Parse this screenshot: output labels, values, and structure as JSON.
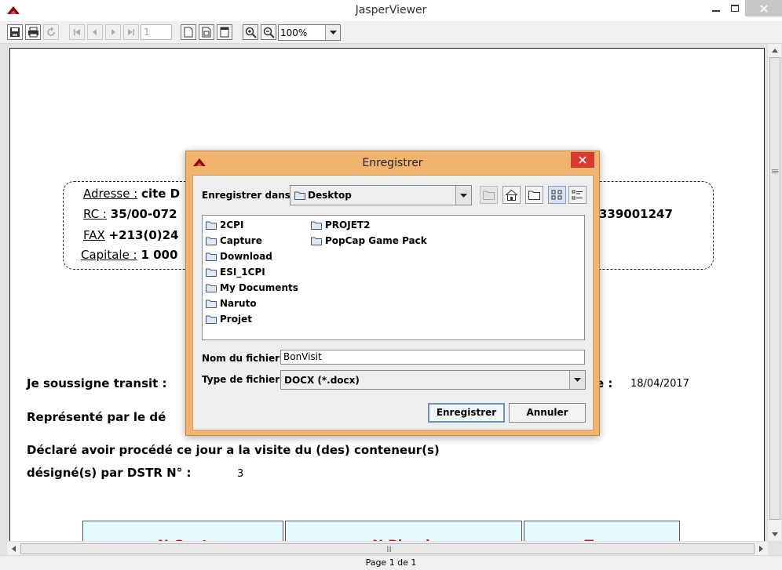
{
  "window": {
    "title": "JasperViewer",
    "minimize_glyph": "—",
    "maximize_glyph": "☐",
    "close_glyph": "✕"
  },
  "toolbar": {
    "save_icon": "save-icon",
    "print_icon": "print-icon",
    "reload_icon": "reload-icon",
    "page_number": "1",
    "zoom_value": "100%"
  },
  "report": {
    "address_label": "Adresse :",
    "address_value": "cite D",
    "rc_label": "RC :",
    "rc_value": "35/00-072",
    "fax_label": "FAX",
    "fax_value": "+213(0)24",
    "capital_label": "Capitale :",
    "capital_value": "1 000",
    "right_number": "339001247",
    "line_transit": "Je soussigne transit :",
    "date_suffix": "e :",
    "date_value": "18/04/2017",
    "line_represented": "Représenté par le dé",
    "line_declared": "Déclaré avoir procédé ce jour a la visite du (des) conteneur(s)",
    "line_designated": "désigné(s) par DSTR N° :",
    "dstr_number": "3",
    "table_headers": [
      "N Cont",
      "N Plomb",
      "Type"
    ]
  },
  "status": {
    "page_label": "Page 1 de 1"
  },
  "dialog": {
    "title": "Enregistrer",
    "close_glyph": "✕",
    "look_in_label": "Enregistrer dans :",
    "look_in_value": "Desktop",
    "files_col1": [
      "2CPI",
      "Capture",
      "Download",
      "ESI_1CPI",
      "My Documents",
      "Naruto",
      "Projet"
    ],
    "files_col2": [
      "PROJET2",
      "PopCap Game Pack"
    ],
    "filename_label": "Nom du fichier :",
    "filename_value": "BonVisit",
    "filetype_label": "Type de fichier :",
    "filetype_value": "DOCX (*.docx)",
    "save_button": "Enregistrer",
    "cancel_button": "Annuler"
  },
  "colors": {
    "dialog_frame": "#f0b46e",
    "close_red": "#d83b2f",
    "table_header_bg": "#e6fbff",
    "table_header_text": "#b81c1c"
  }
}
